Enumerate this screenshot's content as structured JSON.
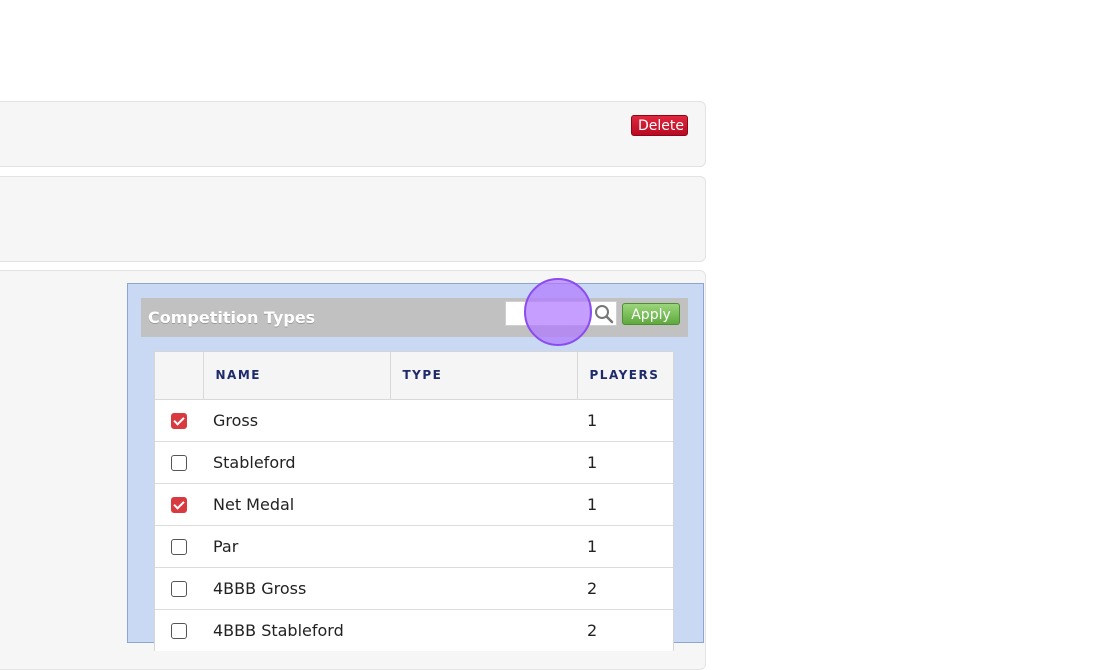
{
  "panels": {
    "delete_label": "Delete"
  },
  "dialog": {
    "title": "Competition Types",
    "search": {
      "value": "",
      "placeholder": ""
    },
    "apply_label": "Apply",
    "table": {
      "columns": [
        "",
        "NAME",
        "TYPE",
        "PLAYERS"
      ],
      "rows": [
        {
          "checked": true,
          "name": "Gross",
          "type": "",
          "players": "1"
        },
        {
          "checked": false,
          "name": "Stableford",
          "type": "",
          "players": "1"
        },
        {
          "checked": true,
          "name": "Net Medal",
          "type": "",
          "players": "1"
        },
        {
          "checked": false,
          "name": "Par",
          "type": "",
          "players": "1"
        },
        {
          "checked": false,
          "name": "4BBB Gross",
          "type": "",
          "players": "2"
        },
        {
          "checked": false,
          "name": "4BBB Stableford",
          "type": "",
          "players": "2"
        }
      ]
    }
  },
  "icons": {
    "search": "search-icon",
    "checkbox_checked": "checkbox-checked-icon",
    "checkbox_unchecked": "checkbox-unchecked-icon"
  },
  "colors": {
    "delete": "#c8102e",
    "apply": "#6cb84b",
    "dialog_bg": "#c9d8f3",
    "header_bg": "#c1c1c1",
    "checked": "#d93a3f",
    "column_header_text": "#1d2a6b"
  }
}
